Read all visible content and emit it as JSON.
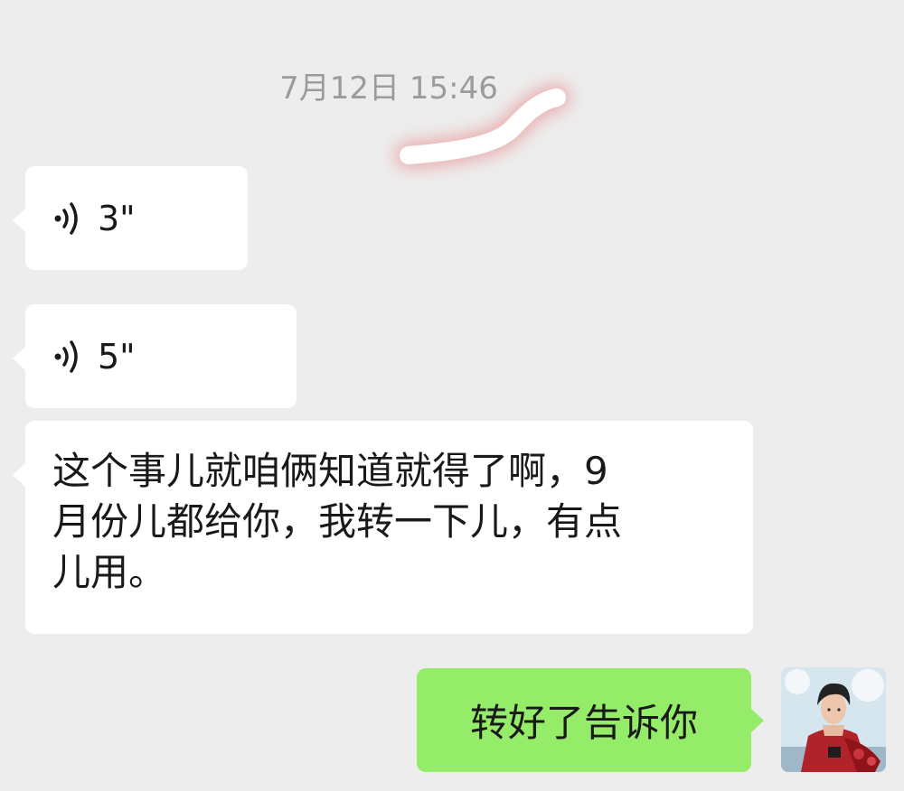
{
  "chat": {
    "timestamp": "7月12日 15:46",
    "messages": [
      {
        "type": "voice",
        "direction": "in",
        "duration": "3\""
      },
      {
        "type": "voice",
        "direction": "in",
        "duration": "5\""
      },
      {
        "type": "text",
        "direction": "in",
        "lines": [
          "这个事儿就咱俩知道就得了啊，9",
          "月份儿都给你，我转一下儿，有点",
          "儿用。"
        ]
      },
      {
        "type": "text",
        "direction": "out",
        "text": "转好了告诉你"
      }
    ]
  },
  "colors": {
    "background": "#ededed",
    "incoming_bubble": "#ffffff",
    "outgoing_bubble": "#95ec69",
    "timestamp_text": "#9b9b9b",
    "scribble": "#ffffff",
    "scribble_glow": "#e87878"
  },
  "icons": {
    "voice": "voice-wave-icon",
    "avatar": "user-avatar"
  }
}
